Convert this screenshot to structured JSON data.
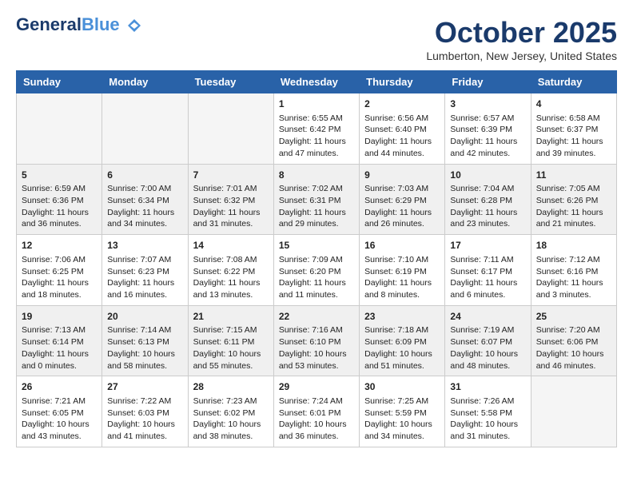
{
  "header": {
    "logo_line1": "General",
    "logo_line1_accent": "Blue",
    "month_title": "October 2025",
    "location": "Lumberton, New Jersey, United States"
  },
  "weekdays": [
    "Sunday",
    "Monday",
    "Tuesday",
    "Wednesday",
    "Thursday",
    "Friday",
    "Saturday"
  ],
  "weeks": [
    [
      {
        "day": "",
        "empty": true
      },
      {
        "day": "",
        "empty": true
      },
      {
        "day": "",
        "empty": true
      },
      {
        "day": "1",
        "sunrise": "6:55 AM",
        "sunset": "6:42 PM",
        "daylight": "11 hours and 47 minutes."
      },
      {
        "day": "2",
        "sunrise": "6:56 AM",
        "sunset": "6:40 PM",
        "daylight": "11 hours and 44 minutes."
      },
      {
        "day": "3",
        "sunrise": "6:57 AM",
        "sunset": "6:39 PM",
        "daylight": "11 hours and 42 minutes."
      },
      {
        "day": "4",
        "sunrise": "6:58 AM",
        "sunset": "6:37 PM",
        "daylight": "11 hours and 39 minutes."
      }
    ],
    [
      {
        "day": "5",
        "sunrise": "6:59 AM",
        "sunset": "6:36 PM",
        "daylight": "11 hours and 36 minutes."
      },
      {
        "day": "6",
        "sunrise": "7:00 AM",
        "sunset": "6:34 PM",
        "daylight": "11 hours and 34 minutes."
      },
      {
        "day": "7",
        "sunrise": "7:01 AM",
        "sunset": "6:32 PM",
        "daylight": "11 hours and 31 minutes."
      },
      {
        "day": "8",
        "sunrise": "7:02 AM",
        "sunset": "6:31 PM",
        "daylight": "11 hours and 29 minutes."
      },
      {
        "day": "9",
        "sunrise": "7:03 AM",
        "sunset": "6:29 PM",
        "daylight": "11 hours and 26 minutes."
      },
      {
        "day": "10",
        "sunrise": "7:04 AM",
        "sunset": "6:28 PM",
        "daylight": "11 hours and 23 minutes."
      },
      {
        "day": "11",
        "sunrise": "7:05 AM",
        "sunset": "6:26 PM",
        "daylight": "11 hours and 21 minutes."
      }
    ],
    [
      {
        "day": "12",
        "sunrise": "7:06 AM",
        "sunset": "6:25 PM",
        "daylight": "11 hours and 18 minutes."
      },
      {
        "day": "13",
        "sunrise": "7:07 AM",
        "sunset": "6:23 PM",
        "daylight": "11 hours and 16 minutes."
      },
      {
        "day": "14",
        "sunrise": "7:08 AM",
        "sunset": "6:22 PM",
        "daylight": "11 hours and 13 minutes."
      },
      {
        "day": "15",
        "sunrise": "7:09 AM",
        "sunset": "6:20 PM",
        "daylight": "11 hours and 11 minutes."
      },
      {
        "day": "16",
        "sunrise": "7:10 AM",
        "sunset": "6:19 PM",
        "daylight": "11 hours and 8 minutes."
      },
      {
        "day": "17",
        "sunrise": "7:11 AM",
        "sunset": "6:17 PM",
        "daylight": "11 hours and 6 minutes."
      },
      {
        "day": "18",
        "sunrise": "7:12 AM",
        "sunset": "6:16 PM",
        "daylight": "11 hours and 3 minutes."
      }
    ],
    [
      {
        "day": "19",
        "sunrise": "7:13 AM",
        "sunset": "6:14 PM",
        "daylight": "11 hours and 0 minutes."
      },
      {
        "day": "20",
        "sunrise": "7:14 AM",
        "sunset": "6:13 PM",
        "daylight": "10 hours and 58 minutes."
      },
      {
        "day": "21",
        "sunrise": "7:15 AM",
        "sunset": "6:11 PM",
        "daylight": "10 hours and 55 minutes."
      },
      {
        "day": "22",
        "sunrise": "7:16 AM",
        "sunset": "6:10 PM",
        "daylight": "10 hours and 53 minutes."
      },
      {
        "day": "23",
        "sunrise": "7:18 AM",
        "sunset": "6:09 PM",
        "daylight": "10 hours and 51 minutes."
      },
      {
        "day": "24",
        "sunrise": "7:19 AM",
        "sunset": "6:07 PM",
        "daylight": "10 hours and 48 minutes."
      },
      {
        "day": "25",
        "sunrise": "7:20 AM",
        "sunset": "6:06 PM",
        "daylight": "10 hours and 46 minutes."
      }
    ],
    [
      {
        "day": "26",
        "sunrise": "7:21 AM",
        "sunset": "6:05 PM",
        "daylight": "10 hours and 43 minutes."
      },
      {
        "day": "27",
        "sunrise": "7:22 AM",
        "sunset": "6:03 PM",
        "daylight": "10 hours and 41 minutes."
      },
      {
        "day": "28",
        "sunrise": "7:23 AM",
        "sunset": "6:02 PM",
        "daylight": "10 hours and 38 minutes."
      },
      {
        "day": "29",
        "sunrise": "7:24 AM",
        "sunset": "6:01 PM",
        "daylight": "10 hours and 36 minutes."
      },
      {
        "day": "30",
        "sunrise": "7:25 AM",
        "sunset": "5:59 PM",
        "daylight": "10 hours and 34 minutes."
      },
      {
        "day": "31",
        "sunrise": "7:26 AM",
        "sunset": "5:58 PM",
        "daylight": "10 hours and 31 minutes."
      },
      {
        "day": "",
        "empty": true
      }
    ]
  ]
}
